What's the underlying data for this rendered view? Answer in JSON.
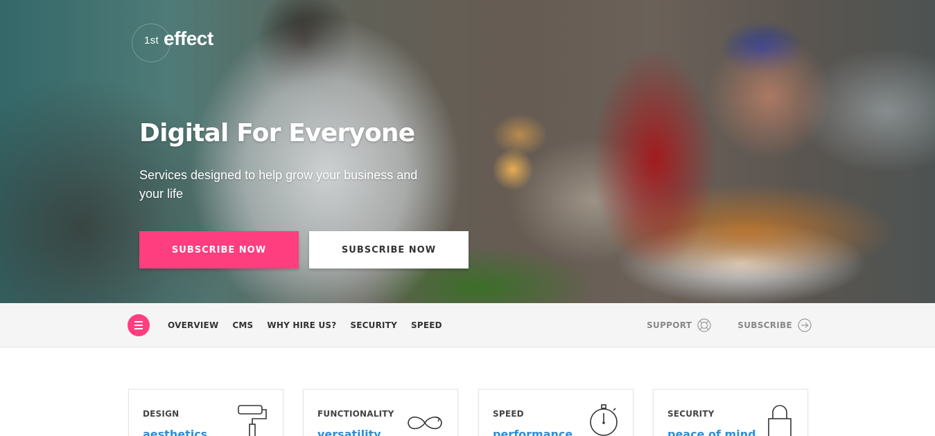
{
  "brand": {
    "small": "1st",
    "big": "effect",
    "accent_color": "#ff3e7f"
  },
  "hero": {
    "title": "Digital For Everyone",
    "subtitle": "Services designed to help grow your business and your life",
    "primary_button": "SUBSCRIBE NOW",
    "secondary_button": "SUBSCRIBE NOW"
  },
  "nav": {
    "menu_icon": "hamburger-icon",
    "links": [
      "OVERVIEW",
      "CMS",
      "WHY HIRE US?",
      "SECURITY",
      "SPEED"
    ],
    "support": {
      "label": "SUPPORT",
      "icon": "lifebuoy-icon"
    },
    "subscribe": {
      "label": "SUBSCRIBE",
      "icon": "arrow-right-circle-icon"
    }
  },
  "cards": [
    {
      "label": "DESIGN",
      "value": "aesthetics",
      "icon": "paint-roller-icon"
    },
    {
      "label": "FUNCTIONALITY",
      "value": "versatility",
      "icon": "infinity-icon"
    },
    {
      "label": "SPEED",
      "value": "performance",
      "icon": "stopwatch-icon"
    },
    {
      "label": "SECURITY",
      "value": "peace of mind",
      "icon": "lock-icon"
    }
  ],
  "colors": {
    "link_blue": "#2b8ed9",
    "nav_bg": "#f5f5f5"
  }
}
